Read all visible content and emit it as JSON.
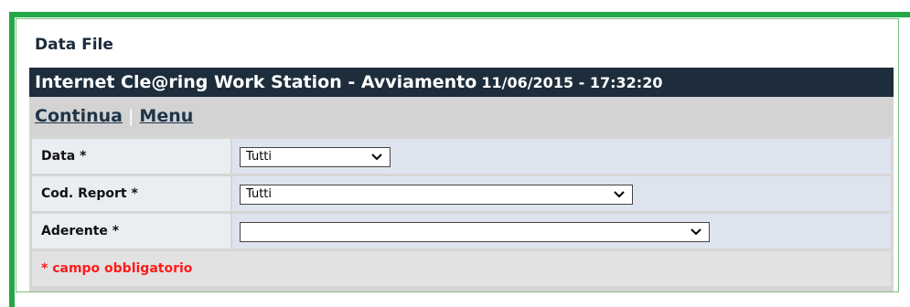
{
  "section": {
    "title": "Data File"
  },
  "header": {
    "title": "Internet Cle@ring Work Station - Avviamento",
    "datetime": "11/06/2015 - 17:32:20"
  },
  "nav": {
    "continua": "Continua",
    "separator": "|",
    "menu": "Menu"
  },
  "form": {
    "fields": [
      {
        "label": "Data *",
        "value": "Tutti"
      },
      {
        "label": "Cod. Report *",
        "value": "Tutti"
      },
      {
        "label": "Aderente *",
        "value": ""
      }
    ],
    "required_note": "* campo obbligatorio"
  },
  "colors": {
    "frame_border": "#22a846",
    "title_bar": "#1d2d3c",
    "required_text": "#ff1a1a"
  }
}
